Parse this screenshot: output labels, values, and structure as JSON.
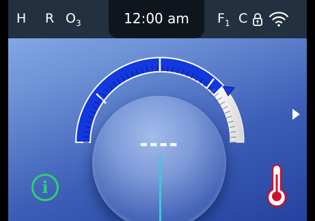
{
  "status_bar": {
    "mode_h": "H",
    "mode_r": "R",
    "ozone_base": "O",
    "ozone_sub": "3",
    "time": "12:00 am",
    "filter_base": "F",
    "filter_sub": "1",
    "mode_c": "C",
    "lock_icon": "lock-icon",
    "wifi_icon": "wifi-icon"
  },
  "dial": {
    "setpoint": "----",
    "active_color": "#1238e0",
    "remaining_color": "#ffffff",
    "needle_color": "#3fc8d6"
  },
  "controls": {
    "info_label": "i",
    "info_color": "#2ed16b",
    "next_icon": "arrow-right-icon",
    "thermometer_icon": "thermometer-icon",
    "thermometer_color": "#d0102a"
  }
}
